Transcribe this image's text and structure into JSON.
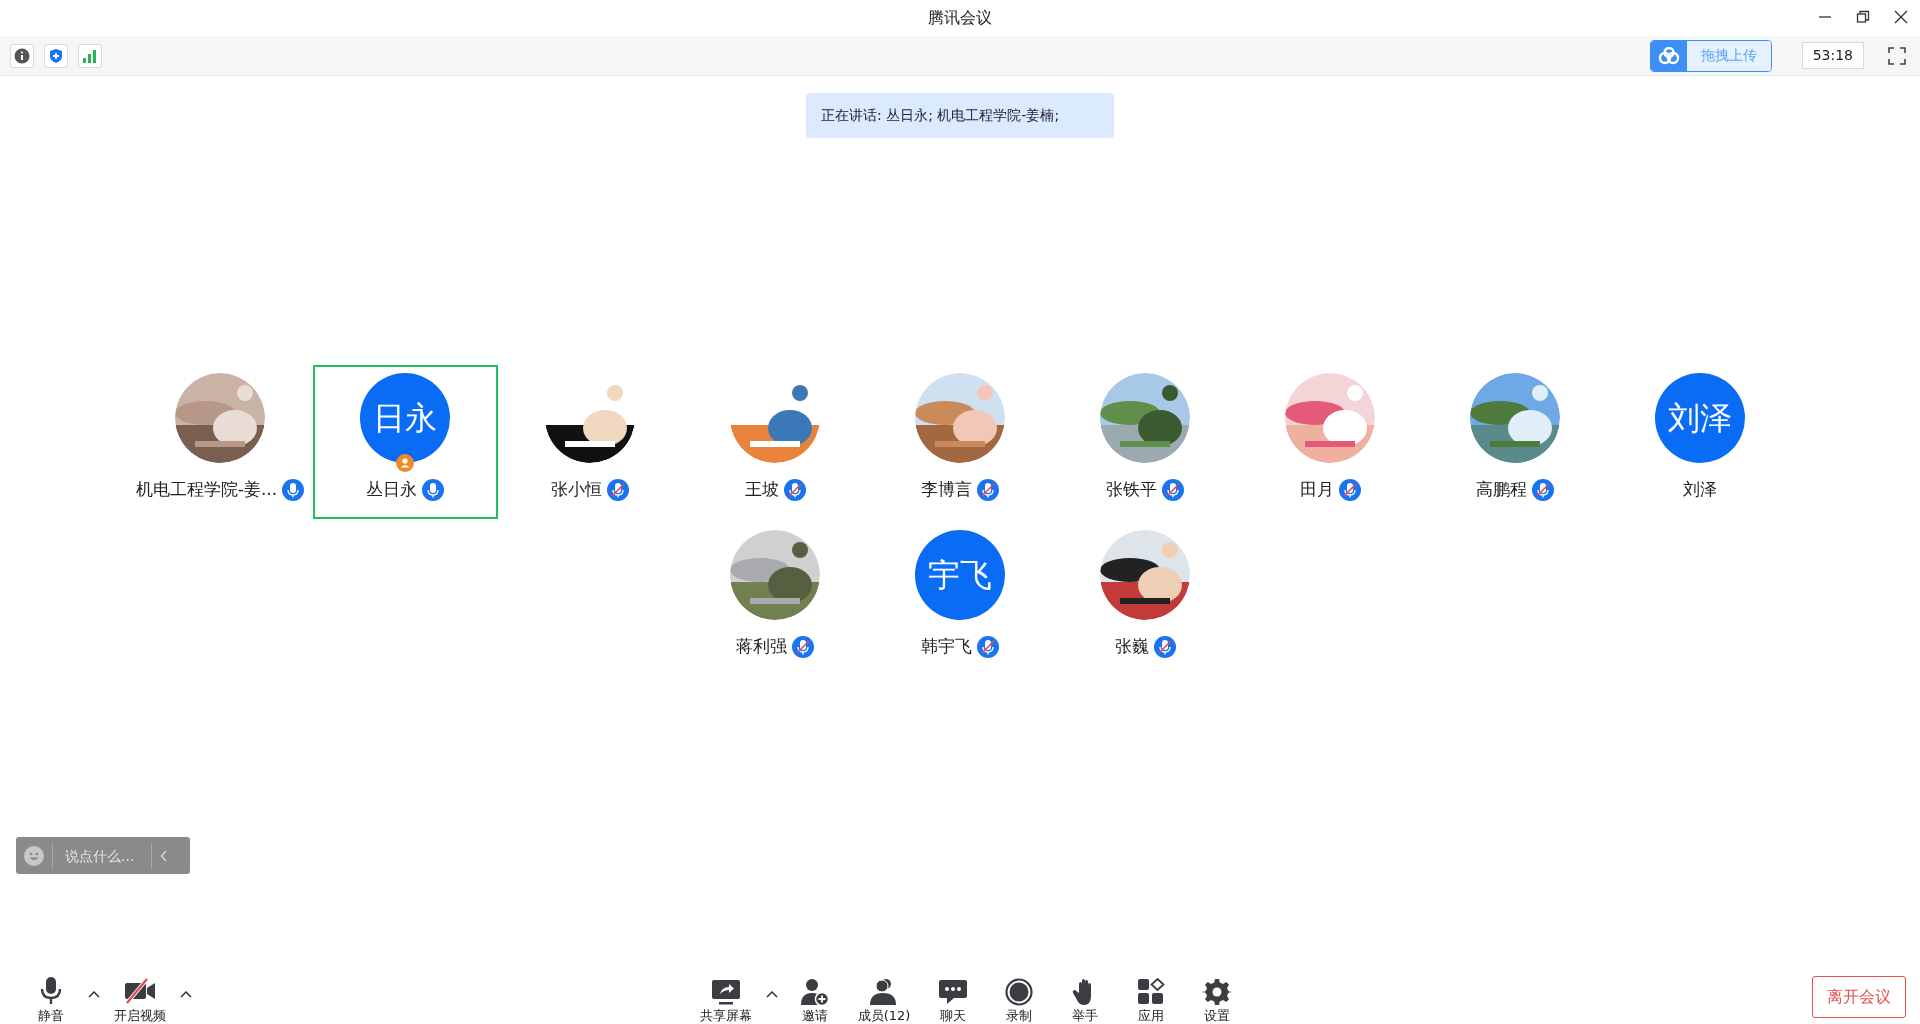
{
  "window": {
    "title": "腾讯会议"
  },
  "top_bar": {
    "upload_button": "拖拽上传",
    "timer": "53:18"
  },
  "speaking_banner": "正在讲话: 丛日永; 机电工程学院-姜楠;",
  "participants": [
    {
      "name": "机电工程学院-姜...",
      "mic": {
        "muted": false
      },
      "host": false,
      "selected": false
    },
    {
      "name": "丛日永",
      "avatar": {
        "kind": "initials",
        "text": "日永"
      },
      "mic": {
        "muted": false
      },
      "host": true,
      "selected": true
    },
    {
      "name": "张小恒",
      "mic": {
        "muted": true
      },
      "host": false,
      "selected": false
    },
    {
      "name": "王坡",
      "mic": {
        "muted": true
      },
      "host": false,
      "selected": false
    },
    {
      "name": "李博言",
      "mic": {
        "muted": true
      },
      "host": false,
      "selected": false
    },
    {
      "name": "张铁平",
      "mic": {
        "muted": true
      },
      "host": false,
      "selected": false
    },
    {
      "name": "田月",
      "mic": {
        "muted": true
      },
      "host": false,
      "selected": false
    },
    {
      "name": "高鹏程",
      "mic": {
        "muted": true
      },
      "host": false,
      "selected": false
    },
    {
      "name": "刘泽",
      "avatar": {
        "kind": "initials",
        "text": "刘泽"
      },
      "host": false,
      "selected": false
    },
    {
      "name": "蒋利强",
      "mic": {
        "muted": true
      },
      "host": false,
      "selected": false
    },
    {
      "name": "韩宇飞",
      "avatar": {
        "kind": "initials",
        "text": "宇飞"
      },
      "mic": {
        "muted": true
      },
      "host": false,
      "selected": false
    },
    {
      "name": "张巍",
      "mic": {
        "muted": true
      },
      "host": false,
      "selected": false
    }
  ],
  "chat_box": {
    "placeholder": "说点什么..."
  },
  "toolbar_left": [
    {
      "label": "静音",
      "off": false,
      "dropdown": true
    },
    {
      "label": "开启视频",
      "off": true,
      "dropdown": true
    }
  ],
  "toolbar_center": [
    {
      "label": "共享屏幕",
      "dropdown": true
    },
    {
      "label": "邀请",
      "dropdown": false
    },
    {
      "label": "成员(12)",
      "dropdown": false
    },
    {
      "label": "聊天",
      "dropdown": false
    },
    {
      "label": "录制",
      "dropdown": false
    },
    {
      "label": "举手",
      "dropdown": false
    },
    {
      "label": "应用",
      "dropdown": false
    },
    {
      "label": "设置",
      "dropdown": false
    }
  ],
  "leave_button": "离开会议"
}
